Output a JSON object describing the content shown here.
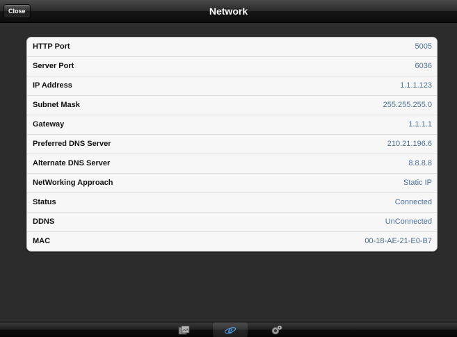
{
  "navbar": {
    "close_label": "Close",
    "title": "Network"
  },
  "settings": {
    "rows": [
      {
        "label": "HTTP Port",
        "value": "5005"
      },
      {
        "label": "Server Port",
        "value": "6036"
      },
      {
        "label": "IP Address",
        "value": "1.1.1.123"
      },
      {
        "label": "Subnet Mask",
        "value": "255.255.255.0"
      },
      {
        "label": "Gateway",
        "value": "1.1.1.1"
      },
      {
        "label": "Preferred DNS Server",
        "value": "210.21.196.6"
      },
      {
        "label": "Alternate DNS Server",
        "value": "8.8.8.8"
      },
      {
        "label": "NetWorking Approach",
        "value": "Static IP"
      },
      {
        "label": "Status",
        "value": "Connected"
      },
      {
        "label": "DDNS",
        "value": "UnConnected"
      },
      {
        "label": "MAC",
        "value": "00-18-AE-21-E0-B7"
      }
    ]
  },
  "tabbar": {
    "tabs": [
      {
        "icon": "gallery-icon"
      },
      {
        "icon": "network-e-icon",
        "active": true
      },
      {
        "icon": "settings-gear-icon"
      }
    ]
  },
  "colors": {
    "value_text": "#4d6f99",
    "label_text": "#111111",
    "background": "#2c2c2c"
  }
}
